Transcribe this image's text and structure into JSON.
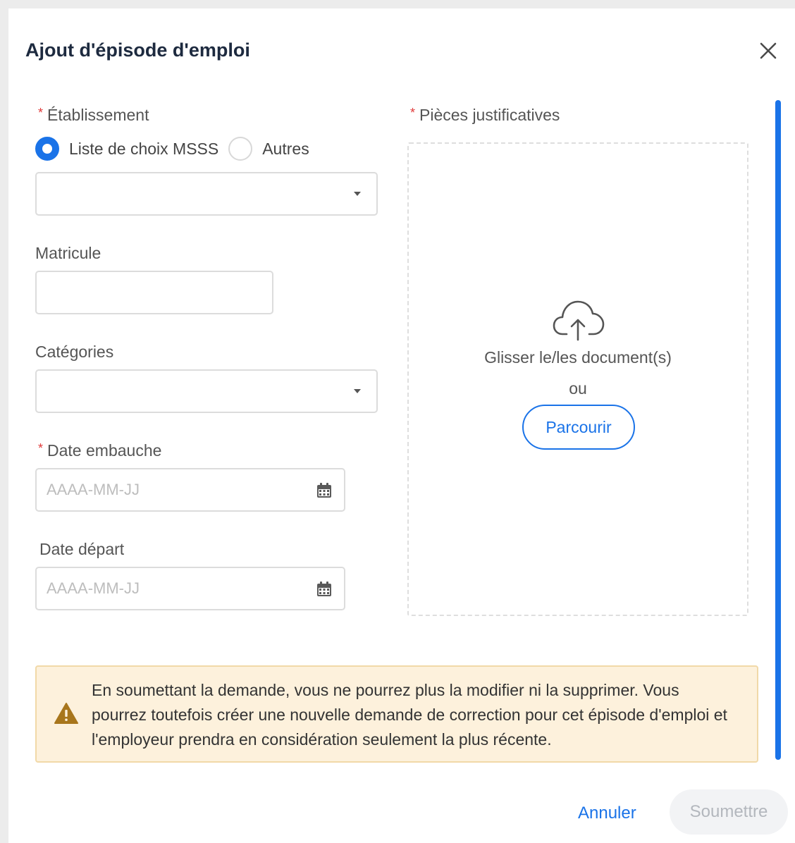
{
  "dialog": {
    "title": "Ajout d'épisode d'emploi"
  },
  "establishment": {
    "label": "Établissement",
    "required_marker": "*",
    "options": [
      {
        "label": "Liste de choix MSSS",
        "checked": true
      },
      {
        "label": "Autres",
        "checked": false
      }
    ],
    "select_value": ""
  },
  "matricule": {
    "label": "Matricule",
    "value": ""
  },
  "categories": {
    "label": "Catégories",
    "select_value": ""
  },
  "hire_date": {
    "label": "Date embauche",
    "required_marker": "*",
    "placeholder": "AAAA-MM-JJ",
    "value": ""
  },
  "departure_date": {
    "label": "Date départ",
    "placeholder": "AAAA-MM-JJ",
    "value": ""
  },
  "attachments": {
    "label": "Pièces justificatives",
    "required_marker": "*",
    "drop_text": "Glisser le/les document(s)",
    "or_text": "ou",
    "browse_label": "Parcourir",
    "icon": "cloud-upload-icon"
  },
  "warning": {
    "icon": "warning-icon",
    "text": "En soumettant la demande, vous ne pourrez plus la modifier ni la supprimer. Vous pourrez toutefois créer une nouvelle demande de correction pour cet épisode d'emploi et l'employeur prendra en considération seulement la plus récente."
  },
  "footer": {
    "cancel_label": "Annuler",
    "submit_label": "Soumettre"
  },
  "colors": {
    "accent": "#1a73e8",
    "required": "#e03a3a",
    "warning_bg": "#fdf1dc",
    "warning_icon": "#a8761c"
  }
}
